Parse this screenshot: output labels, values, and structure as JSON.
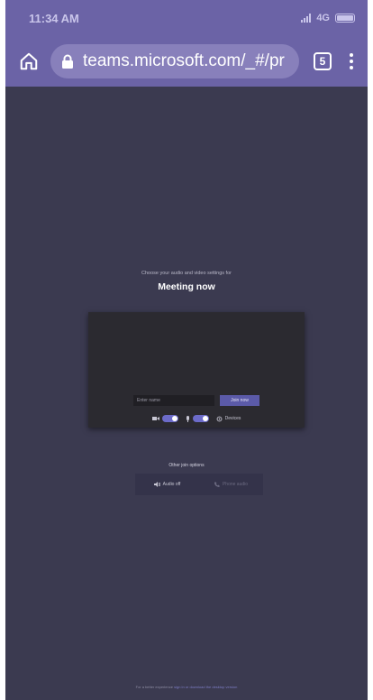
{
  "status_bar": {
    "time": "11:34 AM",
    "network": "4G"
  },
  "browser": {
    "url": "teams.microsoft.com/_#/pr",
    "tab_count": "5"
  },
  "meeting": {
    "subtitle": "Choose your audio and video settings for",
    "title": "Meeting now",
    "name_placeholder": "Enter name",
    "join_label": "Join now",
    "devices_label": "Devices"
  },
  "other_options": {
    "title": "Other join options",
    "audio_off_label": "Audio off",
    "phone_audio_label": "Phone audio"
  },
  "footer": {
    "text_before": "For a better experience",
    "link_text": "sign in or download the desktop version"
  },
  "colors": {
    "accent": "#6b63a6",
    "background": "#3b3a50",
    "button": "#5b5aa8"
  }
}
